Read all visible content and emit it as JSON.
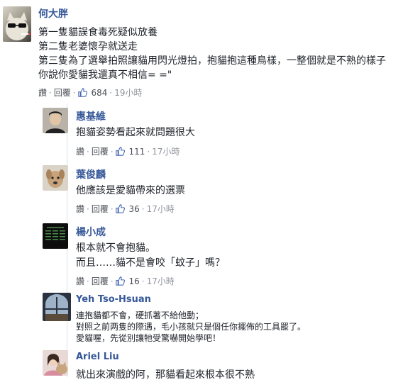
{
  "colors": {
    "name": "#365899",
    "text": "#1d2129",
    "meta": "#90949c",
    "like_blue": "#4267b2"
  },
  "comments": [
    {
      "name": "何大胖",
      "lines": [
        "第一隻貓誤食毒死疑似放養",
        "第二隻老婆懷孕就送走",
        "第三隻為了選舉拍照讓貓用閃光燈拍，抱貓抱這種鳥樣，一整個就是不熟的樣子",
        "你說你愛貓我還真不相信= =\""
      ],
      "actions": {
        "like": "讚",
        "reply": "回覆",
        "count": "684",
        "time": "19小時"
      }
    },
    {
      "name": "惠基維",
      "lines": [
        "抱貓姿勢看起來就問題很大"
      ],
      "actions": {
        "like": "讚",
        "reply": "回覆",
        "count": "111",
        "time": "17小時"
      }
    },
    {
      "name": "葉俊麟",
      "lines": [
        "他應該是愛貓帶來的選票"
      ],
      "actions": {
        "like": "讚",
        "reply": "回覆",
        "count": "36",
        "time": "17小時"
      }
    },
    {
      "name": "楊小成",
      "lines": [
        "根本就不會抱貓。",
        "而且……貓不是會咬「蚊子」嗎？"
      ],
      "actions": {
        "like": "讚",
        "reply": "回覆",
        "count": "16",
        "time": "17小時"
      }
    },
    {
      "name": "Yeh Tso-Hsuan",
      "lines": [
        "連抱貓都不會，硬抓著不給他動；",
        "對照之前两隻的際遇，毛小孩就只是個任你擺佈的工具罷了。",
        "愛貓喔，先從別讓牠受驚嚇開始學吧！"
      ]
    },
    {
      "name": "Ariel Liu",
      "lines": [
        "就出來演戲的阿，那貓看起來根本很不熟"
      ]
    }
  ]
}
